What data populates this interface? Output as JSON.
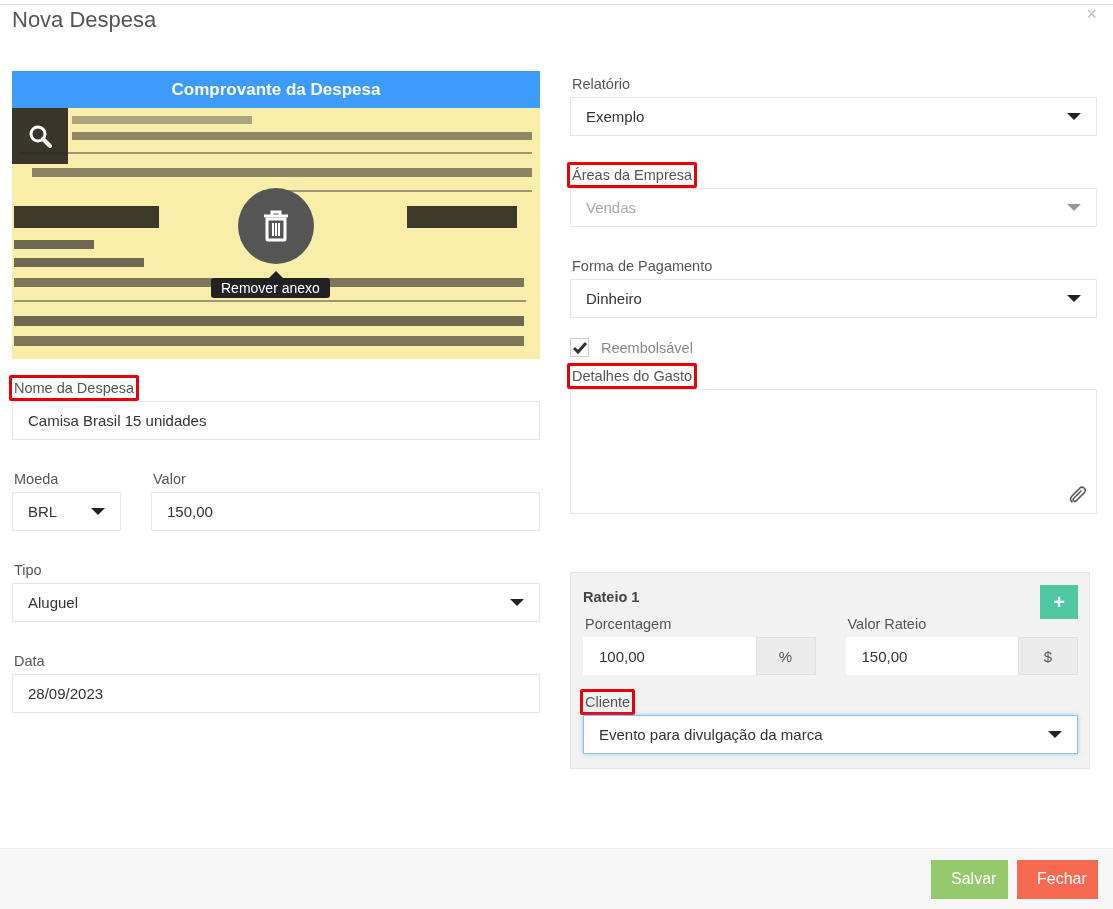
{
  "window": {
    "title": "Nova Despesa",
    "close": "×"
  },
  "attachment": {
    "title": "Comprovante da Despesa",
    "tooltip": "Remover anexo"
  },
  "left_fields": [
    {
      "kind": "text",
      "label": "Nome da Despesa",
      "highlighted": true,
      "value": "Camisa Brasil 15 unidades"
    },
    {
      "kind": "row",
      "fields": [
        {
          "kind": "select",
          "label": "Moeda",
          "highlighted": false,
          "value": "BRL",
          "disabled": false
        },
        {
          "kind": "text",
          "label": "Valor",
          "highlighted": false,
          "value": "150,00"
        }
      ]
    },
    {
      "kind": "select",
      "label": "Tipo",
      "highlighted": false,
      "value": "Aluguel",
      "disabled": false
    },
    {
      "kind": "text",
      "label": "Data",
      "highlighted": false,
      "value": "28/09/2023"
    }
  ],
  "right_fields": [
    {
      "kind": "select",
      "label": "Relatório",
      "highlighted": false,
      "value": "Exemplo",
      "disabled": false
    },
    {
      "kind": "select",
      "label": "Áreas da Empresa",
      "highlighted": true,
      "value": "Vendas",
      "disabled": true
    },
    {
      "kind": "select",
      "label": "Forma de Pagamento",
      "highlighted": false,
      "value": "Dinheiro",
      "disabled": false
    },
    {
      "kind": "checkbox",
      "label": "Reembolsável",
      "checked": true
    },
    {
      "kind": "textarea",
      "label": "Detalhes do Gasto",
      "highlighted": true
    }
  ],
  "rateio": {
    "title": "Rateio 1",
    "add": "+",
    "amounts": [
      {
        "label": "Porcentagem",
        "value": "100,00",
        "unit": "%"
      },
      {
        "label": "Valor Rateio",
        "value": "150,00",
        "unit": "$"
      }
    ],
    "cliente": {
      "label": "Cliente",
      "highlighted": true,
      "value": "Evento para divulgação da marca",
      "focused": true
    }
  },
  "buttons": [
    {
      "label": "Salvar",
      "kind": "save"
    },
    {
      "label": "Fechar",
      "kind": "close"
    }
  ]
}
